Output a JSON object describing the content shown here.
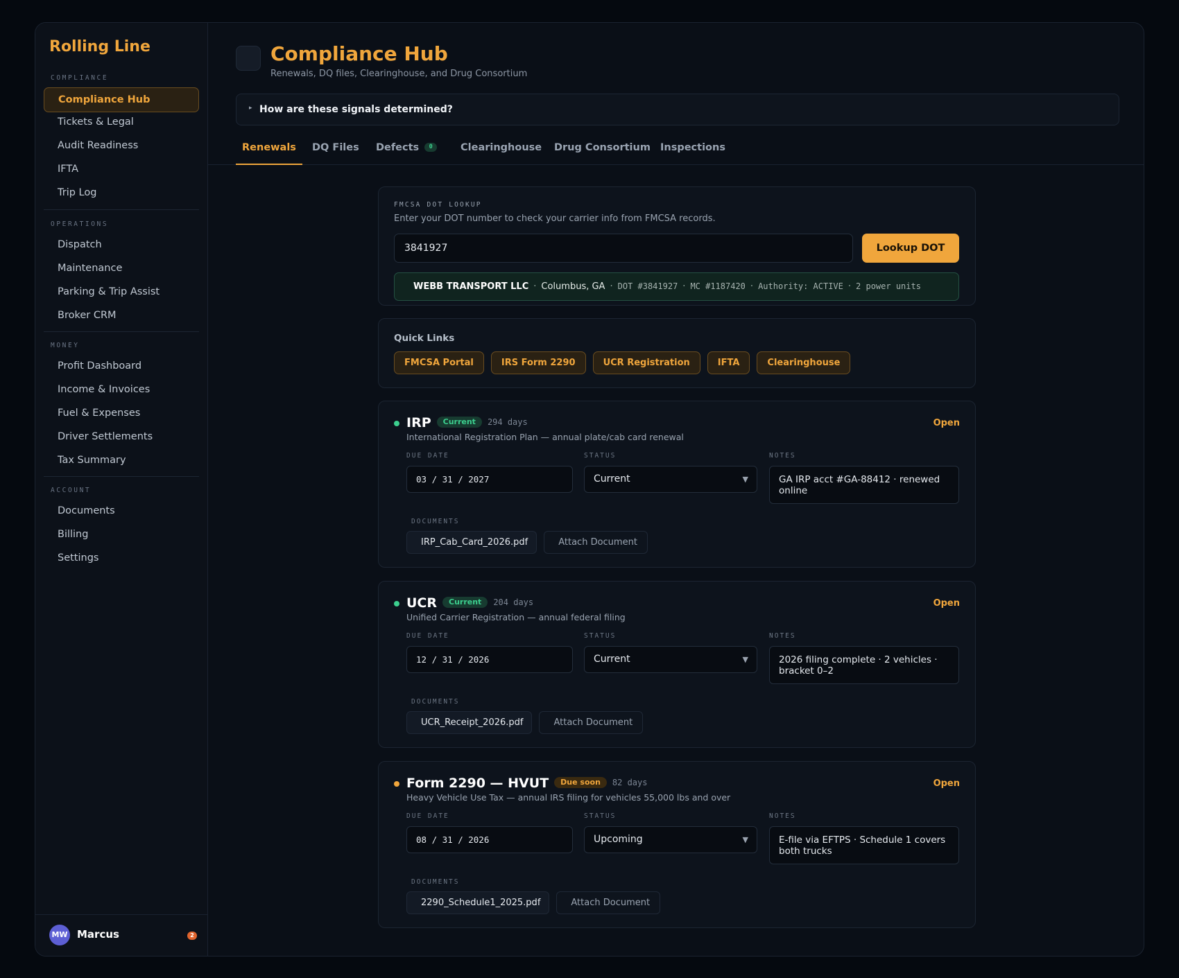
{
  "sidebar": {
    "brand": "Rolling Line",
    "sections": [
      {
        "label": "COMPLIANCE",
        "items": [
          "Compliance Hub",
          "Tickets & Legal",
          "Audit Readiness",
          "IFTA",
          "Trip Log"
        ]
      },
      {
        "label": "OPERATIONS",
        "items": [
          "Dispatch",
          "Maintenance",
          "Parking & Trip Assist",
          "Broker CRM"
        ]
      },
      {
        "label": "MONEY",
        "items": [
          "Profit Dashboard",
          "Income & Invoices",
          "Fuel & Expenses",
          "Driver Settlements",
          "Tax Summary"
        ]
      },
      {
        "label": "ACCOUNT",
        "items": [
          "Documents",
          "Billing",
          "Settings"
        ]
      }
    ],
    "active_item": "Compliance Hub",
    "user": {
      "initials": "MW",
      "name": "Marcus",
      "badge": "2"
    }
  },
  "header": {
    "title": "Compliance Hub",
    "subtitle": "Renewals, DQ files, Clearinghouse, and Drug Consortium",
    "signals_toggle": "How are these signals determined?"
  },
  "tabs": [
    {
      "label": "Renewals"
    },
    {
      "label": "DQ Files"
    },
    {
      "label": "Defects",
      "count": "0"
    },
    {
      "label": "Clearinghouse"
    },
    {
      "label": "Drug Consortium"
    },
    {
      "label": "Inspections"
    }
  ],
  "dot_lookup": {
    "eyebrow": "FMCSA DOT LOOKUP",
    "description": "Enter your DOT number to check your carrier info from FMCSA records.",
    "input_value": "3841927",
    "button_label": "Lookup DOT",
    "result": {
      "name": "WEBB TRANSPORT LLC",
      "location": "Columbus, GA",
      "dot": "DOT #3841927",
      "mc": "MC #1187420",
      "authority": "Authority: ACTIVE",
      "units": "2 power units"
    }
  },
  "quick_links": {
    "title": "Quick Links",
    "links": [
      "FMCSA Portal",
      "IRS Form 2290",
      "UCR Registration",
      "IFTA",
      "Clearinghouse"
    ]
  },
  "field_labels": {
    "due_date": "DUE DATE",
    "status": "STATUS",
    "notes": "NOTES",
    "documents": "DOCUMENTS",
    "open": "Open",
    "attach": "Attach Document"
  },
  "renewals": [
    {
      "title": "IRP",
      "badge": "Current",
      "badge_color": "#3ccf8e",
      "days": "294 days",
      "description": "International Registration Plan — annual plate/cab card renewal",
      "due_date": "03 / 31 / 2027",
      "status": "Current",
      "notes": "GA IRP acct #GA-88412 · renewed online",
      "document": "IRP_Cab_Card_2026.pdf"
    },
    {
      "title": "UCR",
      "badge": "Current",
      "badge_color": "#3ccf8e",
      "days": "204 days",
      "description": "Unified Carrier Registration — annual federal filing",
      "due_date": "12 / 31 / 2026",
      "status": "Current",
      "notes": "2026 filing complete · 2 vehicles · bracket 0–2",
      "document": "UCR_Receipt_2026.pdf"
    },
    {
      "title": "Form 2290 — HVUT",
      "badge": "Due soon",
      "badge_color": "#f0a63c",
      "days": "82 days",
      "description": "Heavy Vehicle Use Tax — annual IRS filing for vehicles 55,000 lbs and over",
      "due_date": "08 / 31 / 2026",
      "status": "Upcoming",
      "notes": "E-file via EFTPS · Schedule 1 covers both trucks",
      "document": "2290_Schedule1_2025.pdf"
    }
  ],
  "colors": {
    "accent": "#f0a63c",
    "success": "#3ccf8e",
    "background": "#0a0f17"
  }
}
